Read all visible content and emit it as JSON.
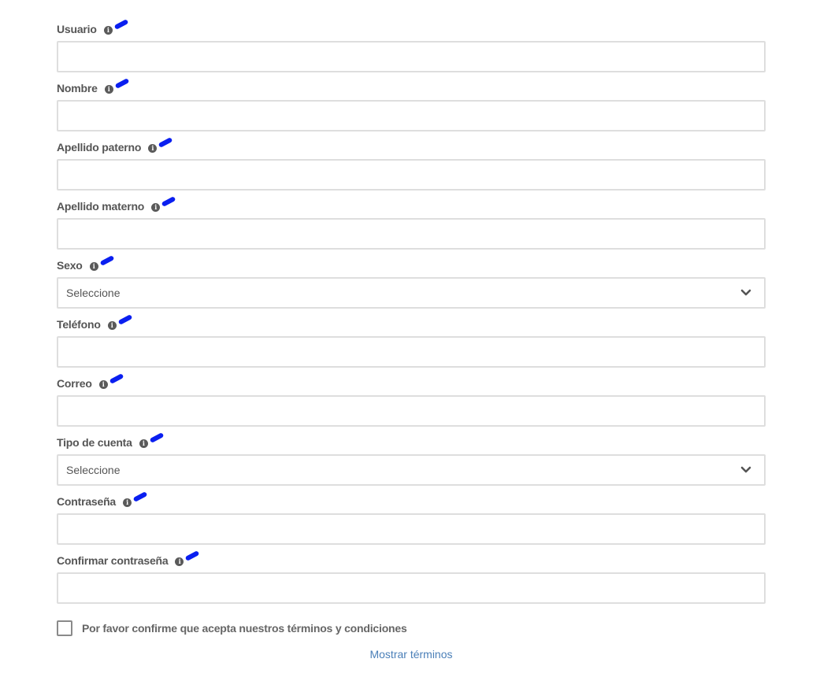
{
  "form": {
    "fields": [
      {
        "label": "Usuario",
        "type": "input",
        "value": ""
      },
      {
        "label": "Nombre",
        "type": "input",
        "value": ""
      },
      {
        "label": "Apellido paterno",
        "type": "input",
        "value": ""
      },
      {
        "label": "Apellido materno",
        "type": "input",
        "value": ""
      },
      {
        "label": "Sexo",
        "type": "select",
        "value": "Seleccione"
      },
      {
        "label": "Teléfono",
        "type": "input",
        "value": ""
      },
      {
        "label": "Correo",
        "type": "input",
        "value": ""
      },
      {
        "label": "Tipo de cuenta",
        "type": "select",
        "value": "Seleccione"
      },
      {
        "label": "Contraseña",
        "type": "input",
        "value": ""
      },
      {
        "label": "Confirmar contraseña",
        "type": "input",
        "value": ""
      }
    ],
    "info_icon": "info-icon",
    "annotation_color": "#0a1ff0"
  },
  "terms": {
    "checkbox_checked": false,
    "checkbox_label": "Por favor confirme que acepta nuestros términos y condiciones",
    "show_terms_link": "Mostrar términos"
  },
  "colors": {
    "link": "#4a7fb8",
    "border": "#dedede",
    "label": "#555555"
  }
}
